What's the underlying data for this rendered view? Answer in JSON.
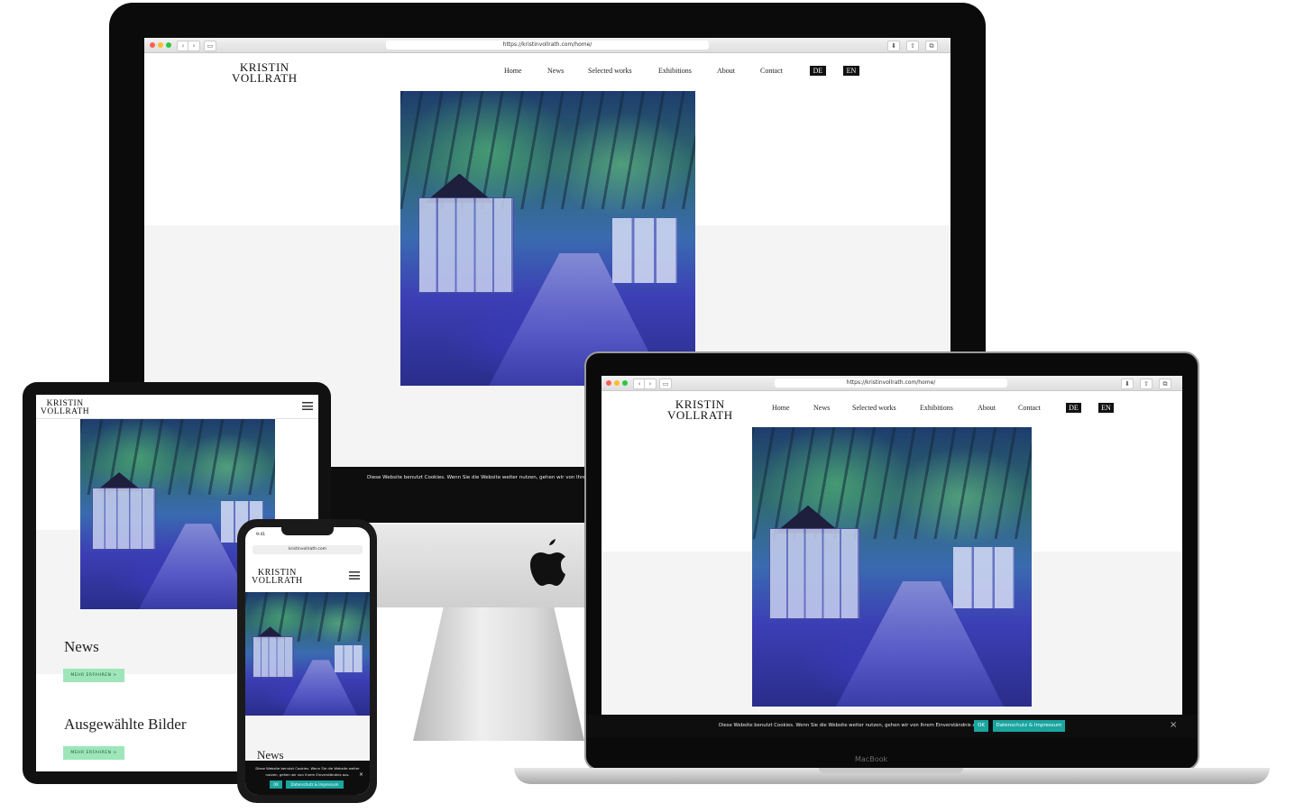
{
  "site": {
    "logo_line1": "KRISTIN",
    "logo_line2": "VOLLRATH",
    "url_desktop": "https://kristinvollrath.com/home/",
    "url_mobile": "kristinvollrath.com",
    "nav": [
      "Home",
      "News",
      "Selected works",
      "Exhibitions",
      "About",
      "Contact"
    ],
    "lang": [
      "DE",
      "EN"
    ]
  },
  "cookie": {
    "imac_text": "Diese Website benutzt Cookies. Wenn Sie die Website weiter nutzen, gehen wir von Ihrem E",
    "macbook_text": "Diese Website benutzt Cookies. Wenn Sie die Website weiter nutzen, gehen wir von Ihrem Einverständnis aus.",
    "phone_text": "Diese Website benutzt Cookies. Wenn Sie die Website weiter nutzen, gehen wir von Ihrem Einverständnis aus.",
    "ok": "OK",
    "privacy": "Datenschutz & Impressum",
    "close": "×"
  },
  "tablet": {
    "section1": "News",
    "section2": "Ausgewählte Bilder",
    "more": "MEHR ERFAHREN  >"
  },
  "phone": {
    "time": "9:41",
    "section1": "News"
  },
  "macbook_label": "MacBook",
  "colors": {
    "teal": "#1aa5a0",
    "mint": "#9ee6b9",
    "dark": "#111111"
  }
}
